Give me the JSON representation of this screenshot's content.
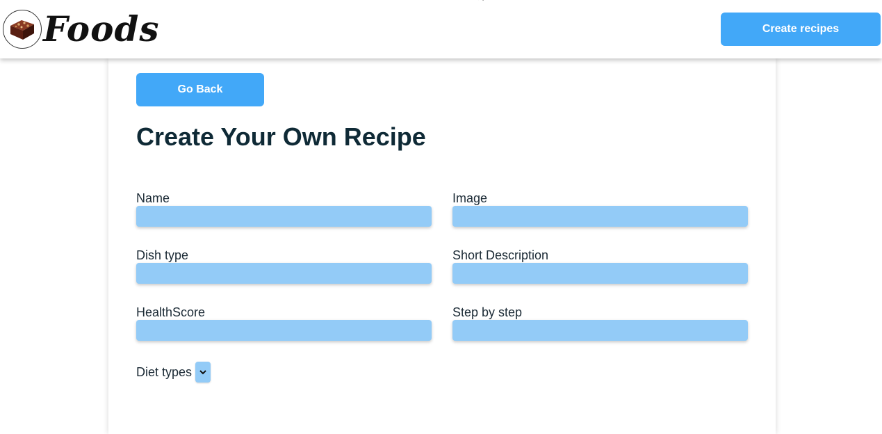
{
  "navbar": {
    "logo_text": "Foods",
    "create_label": "Create recipes"
  },
  "form": {
    "back_label": "Go Back",
    "title": "Create Your Own Recipe",
    "fields": {
      "name": {
        "label": "Name",
        "value": ""
      },
      "image": {
        "label": "Image",
        "value": ""
      },
      "dish_type": {
        "label": "Dish type",
        "value": ""
      },
      "short_description": {
        "label": "Short Description",
        "value": ""
      },
      "health_score": {
        "label": "HealthScore",
        "value": ""
      },
      "step_by_step": {
        "label": "Step by step",
        "value": ""
      }
    },
    "diet_types": {
      "label": "Diet types",
      "selected": ""
    }
  },
  "colors": {
    "accent": "#42a8f8",
    "input_bg": "#93cbf7",
    "title": "#0f2a36"
  },
  "icons": {
    "logo": "brownie-icon",
    "select_arrow": "chevron-down-icon",
    "pointer": "cursor-icon"
  }
}
